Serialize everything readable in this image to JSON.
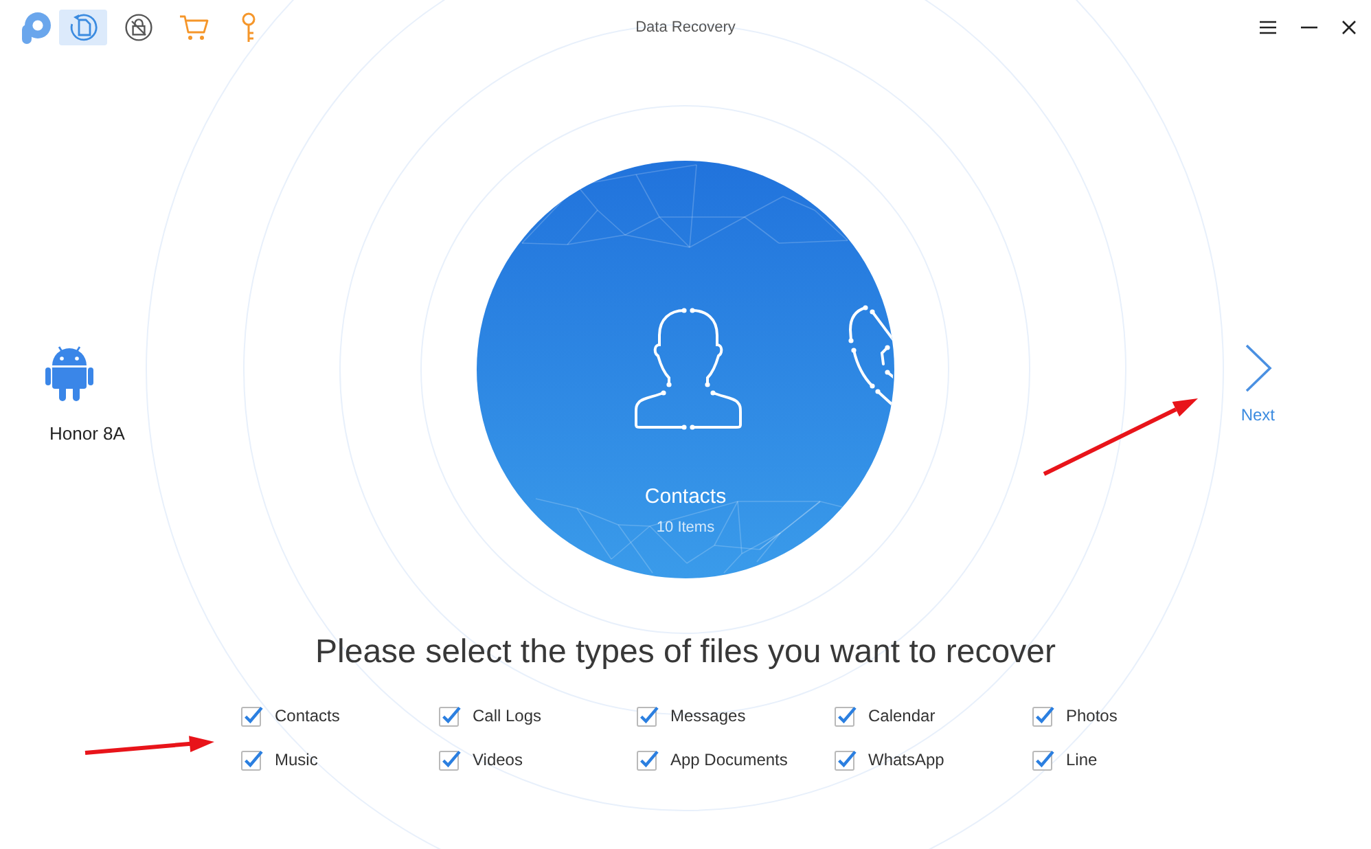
{
  "window": {
    "title": "Data Recovery"
  },
  "toolbar": [
    {
      "kind": "document",
      "selected": true
    },
    {
      "kind": "lock",
      "selected": false
    },
    {
      "kind": "cart",
      "selected": false
    },
    {
      "kind": "key",
      "selected": false
    }
  ],
  "device": {
    "name": "Honor 8A"
  },
  "carousel": {
    "title": "Contacts",
    "count": "10 Items"
  },
  "next": {
    "label": "Next"
  },
  "prompt": "Please select the types of files you want to recover",
  "file_types": [
    {
      "label": "Contacts",
      "checked": true
    },
    {
      "label": "Call Logs",
      "checked": true
    },
    {
      "label": "Messages",
      "checked": true
    },
    {
      "label": "Calendar",
      "checked": true
    },
    {
      "label": "Photos",
      "checked": true
    },
    {
      "label": "Music",
      "checked": true
    },
    {
      "label": "Videos",
      "checked": true
    },
    {
      "label": "App Documents",
      "checked": true
    },
    {
      "label": "WhatsApp",
      "checked": true
    },
    {
      "label": "Line",
      "checked": true
    }
  ]
}
